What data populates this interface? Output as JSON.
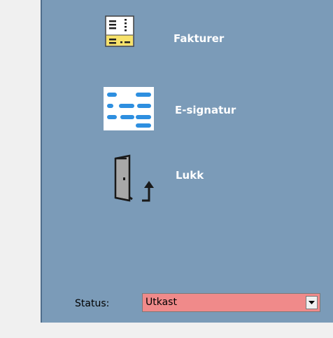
{
  "menu": {
    "items": [
      {
        "label": "Fakturer",
        "icon": "invoice-document-icon"
      },
      {
        "label": "E-signatur",
        "icon": "esignature-lines-icon"
      },
      {
        "label": "Lukk",
        "icon": "exit-door-icon"
      }
    ]
  },
  "status": {
    "label": "Status:",
    "value": "Utkast",
    "highlight_color": "#f08a8a"
  },
  "colors": {
    "panel": "#7b9bb8",
    "background": "#f0f0f0"
  }
}
